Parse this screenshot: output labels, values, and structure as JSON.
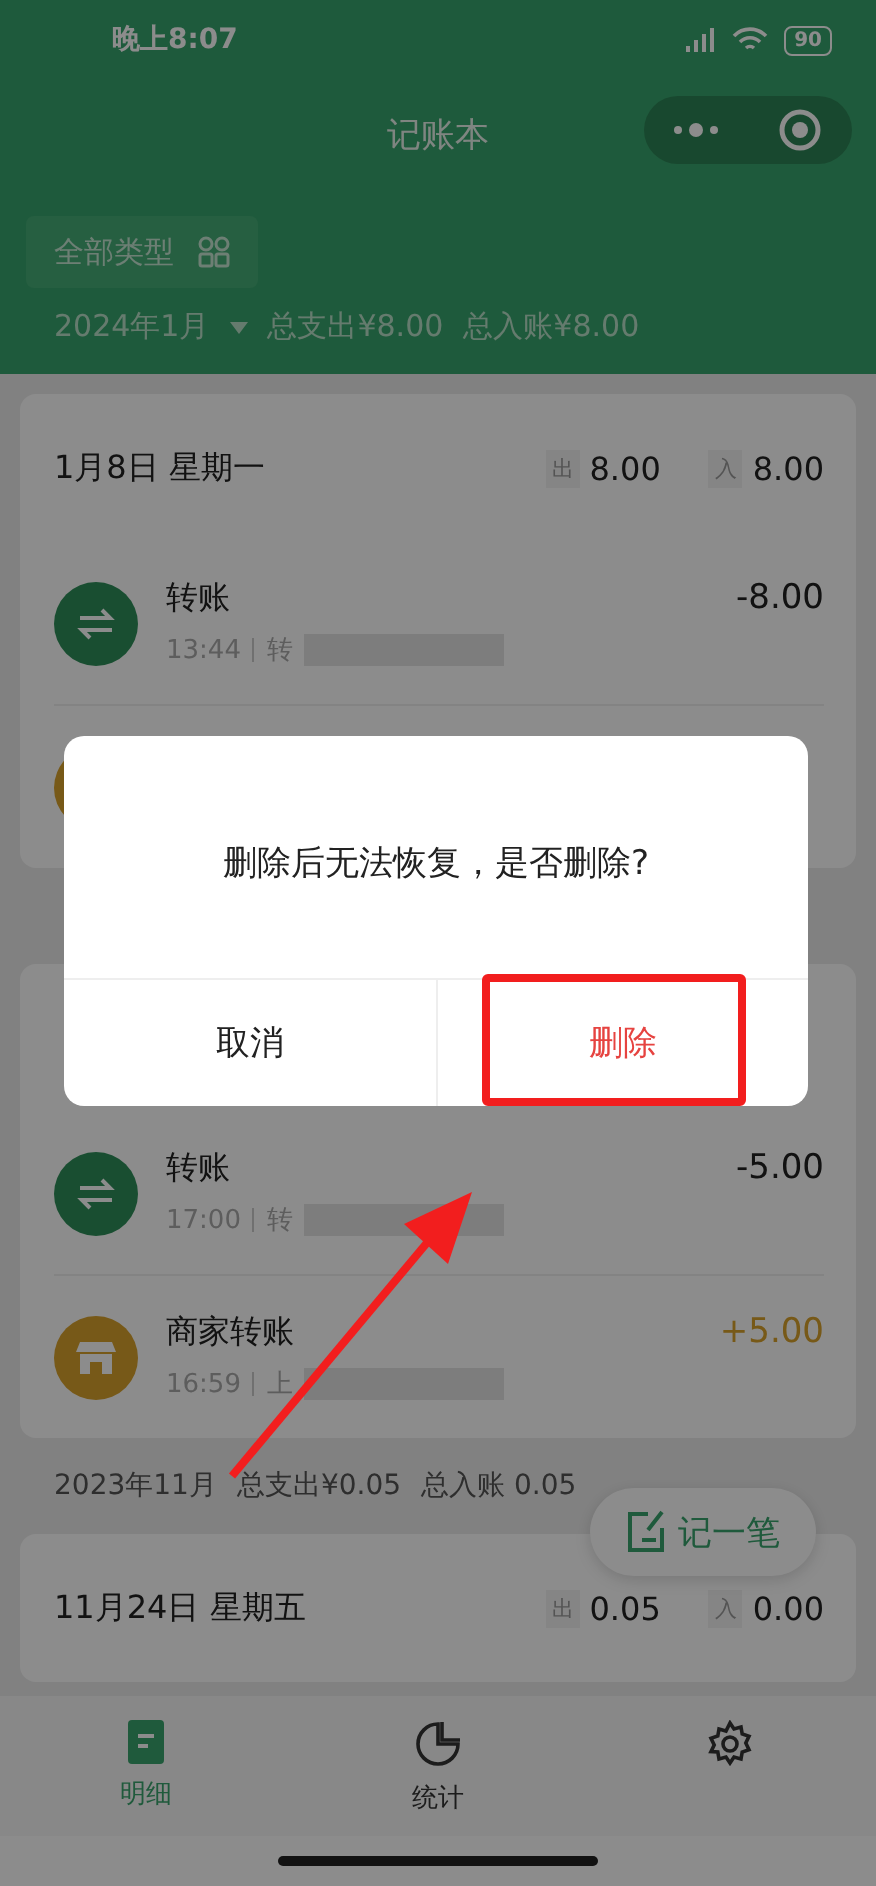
{
  "status_bar": {
    "time": "晚上8:07",
    "battery": "90"
  },
  "title": "记账本",
  "filter": {
    "label": "全部类型"
  },
  "summary": {
    "month": "2024年1月",
    "expense": "总支出¥8.00",
    "income": "总入账¥8.00"
  },
  "feed": [
    {
      "kind": "day",
      "date": "1月8日 星期一",
      "out_label": "出",
      "out": "8.00",
      "in_label": "入",
      "in": "8.00",
      "rows": [
        {
          "kind": "transfer",
          "name": "转账",
          "time": "13:44",
          "note": "转",
          "amount": "-8.00",
          "income": false
        },
        {
          "kind": "shop"
        }
      ]
    },
    {
      "kind": "month"
    },
    {
      "kind": "day",
      "rows": [
        {
          "kind": "transfer",
          "name": "转账",
          "time": "17:00",
          "note": "转",
          "amount": "-5.00",
          "income": false
        },
        {
          "kind": "shop",
          "name": "商家转账",
          "time": "16:59",
          "note": "上",
          "amount": "+5.00",
          "income": true
        }
      ]
    },
    {
      "kind": "month",
      "month": "2023年11月",
      "expense": "总支出¥0.05",
      "income": "总入账 0.05"
    },
    {
      "kind": "day",
      "date": "11月24日 星期五",
      "out_label": "出",
      "out": "0.05",
      "in_label": "入",
      "in": "0.00"
    }
  ],
  "fab": {
    "label": "记一笔"
  },
  "tabs": [
    {
      "label": "明细",
      "kind": "list",
      "selected": true
    },
    {
      "label": "统计",
      "kind": "chart",
      "selected": false
    },
    {
      "kind": "settings",
      "selected": false
    }
  ],
  "dialog": {
    "message": "删除后无法恢复，是否删除?",
    "buttons": [
      {
        "label": "取消",
        "kind": "cancel"
      },
      {
        "label": "删除",
        "kind": "danger"
      }
    ]
  }
}
